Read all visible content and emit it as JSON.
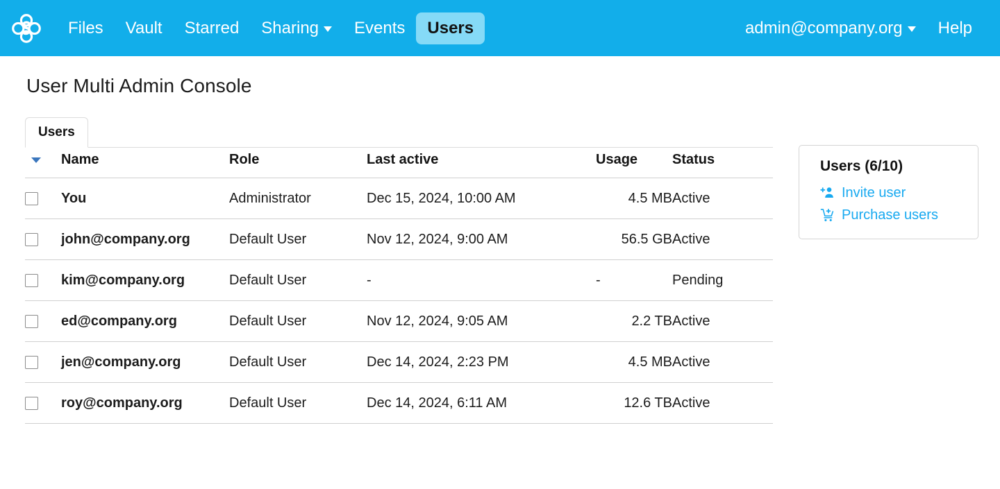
{
  "header": {
    "logo_icon": "sync-clover-logo",
    "nav_items": [
      {
        "label": "Files",
        "name": "nav-files",
        "active": false,
        "caret": false
      },
      {
        "label": "Vault",
        "name": "nav-vault",
        "active": false,
        "caret": false
      },
      {
        "label": "Starred",
        "name": "nav-starred",
        "active": false,
        "caret": false
      },
      {
        "label": "Sharing",
        "name": "nav-sharing",
        "active": false,
        "caret": true
      },
      {
        "label": "Events",
        "name": "nav-events",
        "active": false,
        "caret": false
      },
      {
        "label": "Users",
        "name": "nav-users",
        "active": true,
        "caret": false
      }
    ],
    "account_label": "admin@company.org",
    "account_caret_icon": "chevron-down-icon",
    "help_label": "Help",
    "bar_color": "#12AEEA",
    "active_pill_color": "#85DAF7"
  },
  "page": {
    "title": "User Multi Admin Console"
  },
  "tabs": [
    {
      "label": "Users",
      "active": true
    }
  ],
  "table": {
    "sort_caret_icon": "sort-descending-caret-icon",
    "sort_caret_color": "#3a76bd",
    "columns": [
      "Name",
      "Role",
      "Last active",
      "Usage",
      "Status"
    ],
    "rows": [
      {
        "checked": false,
        "name": "You",
        "role": "Administrator",
        "last_active": "Dec 15, 2024, 10:00 AM",
        "usage": "4.5 MB",
        "status": "Active"
      },
      {
        "checked": false,
        "name": "john@company.org",
        "role": "Default User",
        "last_active": "Nov 12, 2024, 9:00 AM",
        "usage": "56.5 GB",
        "status": "Active"
      },
      {
        "checked": false,
        "name": "kim@company.org",
        "role": "Default User",
        "last_active": "-",
        "usage": "-",
        "status": "Pending"
      },
      {
        "checked": false,
        "name": "ed@company.org",
        "role": "Default User",
        "last_active": "Nov 12, 2024, 9:05 AM",
        "usage": "2.2 TB",
        "status": "Active"
      },
      {
        "checked": false,
        "name": "jen@company.org",
        "role": "Default User",
        "last_active": "Dec 14, 2024, 2:23 PM",
        "usage": "4.5 MB",
        "status": "Active"
      },
      {
        "checked": false,
        "name": "roy@company.org",
        "role": "Default User",
        "last_active": "Dec 14, 2024, 6:11 AM",
        "usage": "12.6 TB",
        "status": "Active"
      }
    ]
  },
  "side_card": {
    "title": "Users (6/10)",
    "links": [
      {
        "label": "Invite user",
        "icon": "person-add-icon"
      },
      {
        "label": "Purchase users",
        "icon": "cart-plus-icon"
      }
    ],
    "link_color": "#17A9F0"
  }
}
